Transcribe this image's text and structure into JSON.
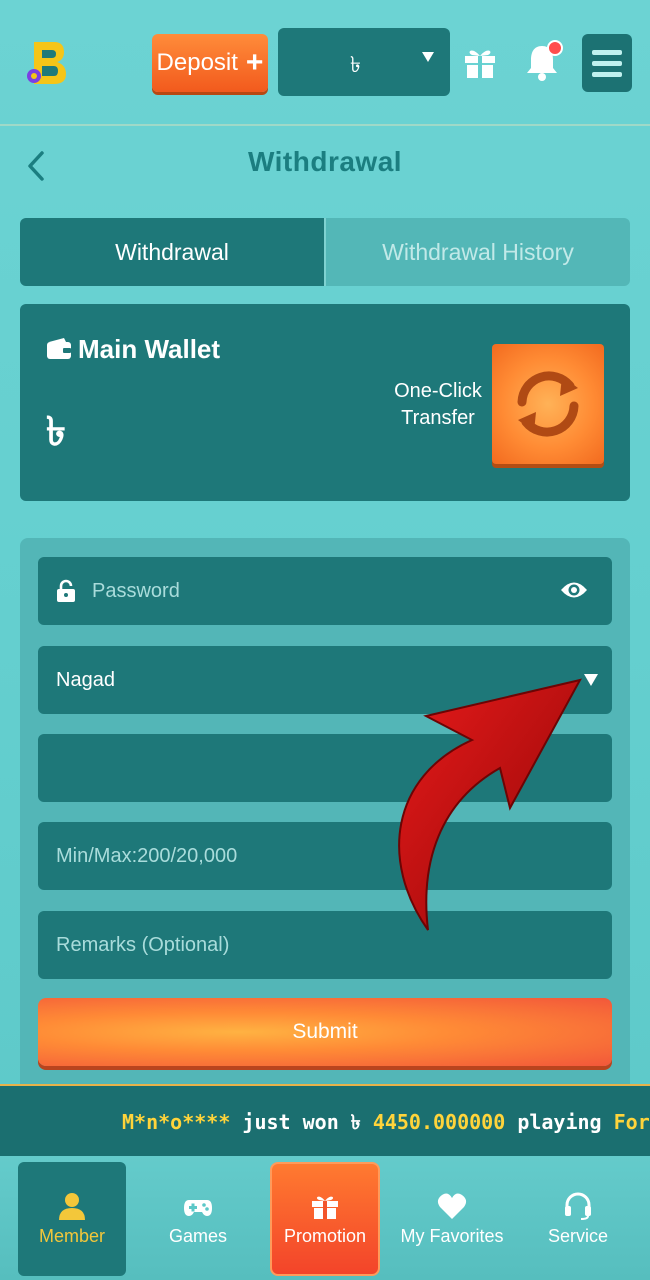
{
  "header": {
    "deposit_label": "Deposit",
    "deposit_plus": "+",
    "balance_currency": "৳",
    "notification_badge_color": "#ff4d4d"
  },
  "page": {
    "title": "Withdrawal"
  },
  "tabs": [
    {
      "label": "Withdrawal",
      "active": true
    },
    {
      "label": "Withdrawal History",
      "active": false
    }
  ],
  "wallet": {
    "title": "Main Wallet",
    "currency": "৳",
    "transfer_label_line1": "One-Click",
    "transfer_label_line2": "Transfer"
  },
  "form": {
    "password_placeholder": "Password",
    "method_value": "Nagad",
    "account_value": "",
    "amount_placeholder": "Min/Max:200/20,000",
    "remarks_placeholder": "Remarks (Optional)",
    "submit_label": "Submit"
  },
  "ticker": {
    "user": "M*n*o****",
    "text1": " just won ",
    "currency": "৳",
    "amount": " 4450.000000",
    "text2": " playing ",
    "game": "Fortune"
  },
  "nav": [
    {
      "label": "Member",
      "icon": "person-icon",
      "active": true
    },
    {
      "label": "Games",
      "icon": "gamepad-icon",
      "active": false
    },
    {
      "label": "Promotion",
      "icon": "gift-icon",
      "active": false
    },
    {
      "label": "My Favorites",
      "icon": "heart-icon",
      "active": false
    },
    {
      "label": "Service",
      "icon": "headset-icon",
      "active": false
    }
  ],
  "colors": {
    "background": "#64cfcf",
    "panel": "#1e7879",
    "accent_orange": "#ff8b34",
    "highlight_yellow": "#ffd43b"
  }
}
